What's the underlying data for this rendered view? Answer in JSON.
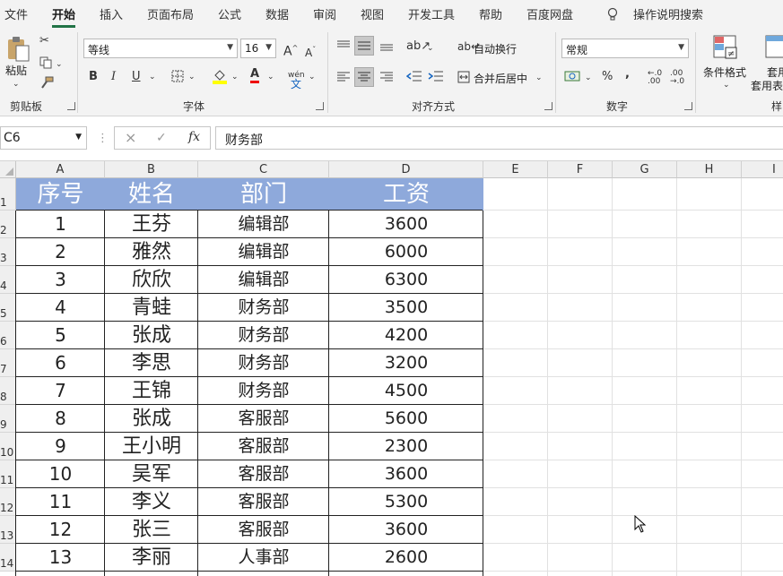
{
  "tabs": [
    "文件",
    "开始",
    "插入",
    "页面布局",
    "公式",
    "数据",
    "审阅",
    "视图",
    "开发工具",
    "帮助",
    "百度网盘",
    "操作说明搜索"
  ],
  "active_tab": "开始",
  "ribbon": {
    "clipboard": {
      "paste": "粘贴",
      "label": "剪贴板"
    },
    "font": {
      "name": "等线",
      "size": "16",
      "label": "字体",
      "bold": "B",
      "italic": "I",
      "underline": "U",
      "wen": "wén",
      "grow": "A",
      "shrink": "A"
    },
    "alignment": {
      "wrap": "自动换行",
      "merge": "合并后居中",
      "label": "对齐方式"
    },
    "number": {
      "format": "常规",
      "label": "数字",
      "percent": "%",
      "comma": ",",
      "inc_decimal": "←.0 .00",
      "dec_decimal": ".00 →.0"
    },
    "styles": {
      "conditional": "条件格式",
      "table_partial": "套用表格格",
      "label_partial": "样"
    }
  },
  "formula_bar": {
    "name_box": "C6",
    "formula": "财务部",
    "cancel": "×",
    "enter": "✓",
    "fx": "fx"
  },
  "columns": [
    "A",
    "B",
    "C",
    "D",
    "E",
    "F",
    "G",
    "H",
    "I"
  ],
  "row_numbers": [
    "1",
    "2",
    "3",
    "4",
    "5",
    "6",
    "7",
    "8",
    "9",
    "10",
    "11",
    "12",
    "13",
    "14"
  ],
  "table": {
    "headers": [
      "序号",
      "姓名",
      "部门",
      "工资"
    ],
    "rows": [
      [
        "1",
        "王芬",
        "编辑部",
        "3600"
      ],
      [
        "2",
        "雅然",
        "编辑部",
        "6000"
      ],
      [
        "3",
        "欣欣",
        "编辑部",
        "6300"
      ],
      [
        "4",
        "青蛙",
        "财务部",
        "3500"
      ],
      [
        "5",
        "张成",
        "财务部",
        "4200"
      ],
      [
        "6",
        "李思",
        "财务部",
        "3200"
      ],
      [
        "7",
        "王锦",
        "财务部",
        "4500"
      ],
      [
        "8",
        "张成",
        "客服部",
        "5600"
      ],
      [
        "9",
        "王小明",
        "客服部",
        "2300"
      ],
      [
        "10",
        "吴军",
        "客服部",
        "3600"
      ],
      [
        "11",
        "李义",
        "客服部",
        "5300"
      ],
      [
        "12",
        "张三",
        "客服部",
        "3600"
      ],
      [
        "13",
        "李丽",
        "人事部",
        "2600"
      ]
    ]
  },
  "colors": {
    "header_fill": "#8ea9db",
    "accent": "#217346"
  }
}
